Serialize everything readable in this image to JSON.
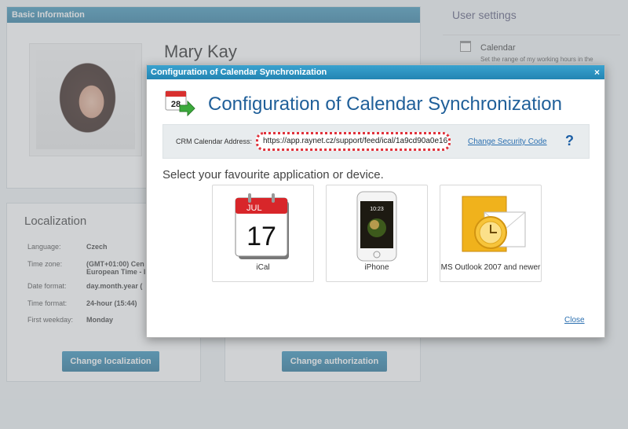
{
  "background": {
    "basic_info": {
      "header": "Basic Information",
      "name": "Mary Kay"
    },
    "localization": {
      "title": "Localization",
      "rows": [
        {
          "key": "Language:",
          "value": "Czech"
        },
        {
          "key": "Time zone:",
          "value": "(GMT+01:00) Cen"
        },
        {
          "key": "",
          "value": "European Time - I"
        },
        {
          "key": "Date format:",
          "value": "day.month.year ("
        },
        {
          "key": "Time format:",
          "value": "24-hour (15:44)"
        },
        {
          "key": "First weekday:",
          "value": "Monday"
        }
      ],
      "button": "Change localization"
    },
    "authorization": {
      "button": "Change authorization"
    },
    "user_settings": {
      "title": "User settings",
      "calendar_title": "Calendar",
      "calendar_sub": "Set the range of my working hours in the"
    }
  },
  "modal": {
    "header": "Configuration of Calendar Synchronization",
    "close_symbol": "×",
    "title": "Configuration of Calendar Synchronization",
    "address_label": "CRM Calendar Address:",
    "address_value": "https://app.raynet.cz/support/feed/ical/1a9cd90a0e16",
    "security_link": "Change Security Code",
    "help_symbol": "?",
    "select_text": "Select your favourite application or device.",
    "options": [
      {
        "label": "iCal",
        "icon": "ical-calendar-icon"
      },
      {
        "label": "iPhone",
        "icon": "iphone-icon"
      },
      {
        "label": "MS Outlook 2007 and newer",
        "icon": "outlook-icon"
      }
    ],
    "close_link": "Close",
    "ical_month": "JUL",
    "ical_day": "17",
    "header_icon_day": "28",
    "iphone_time": "10:23"
  },
  "colors": {
    "header_blue": "#2a7aa0",
    "title_blue": "#1f5f99",
    "highlight_red": "#e0323b"
  }
}
